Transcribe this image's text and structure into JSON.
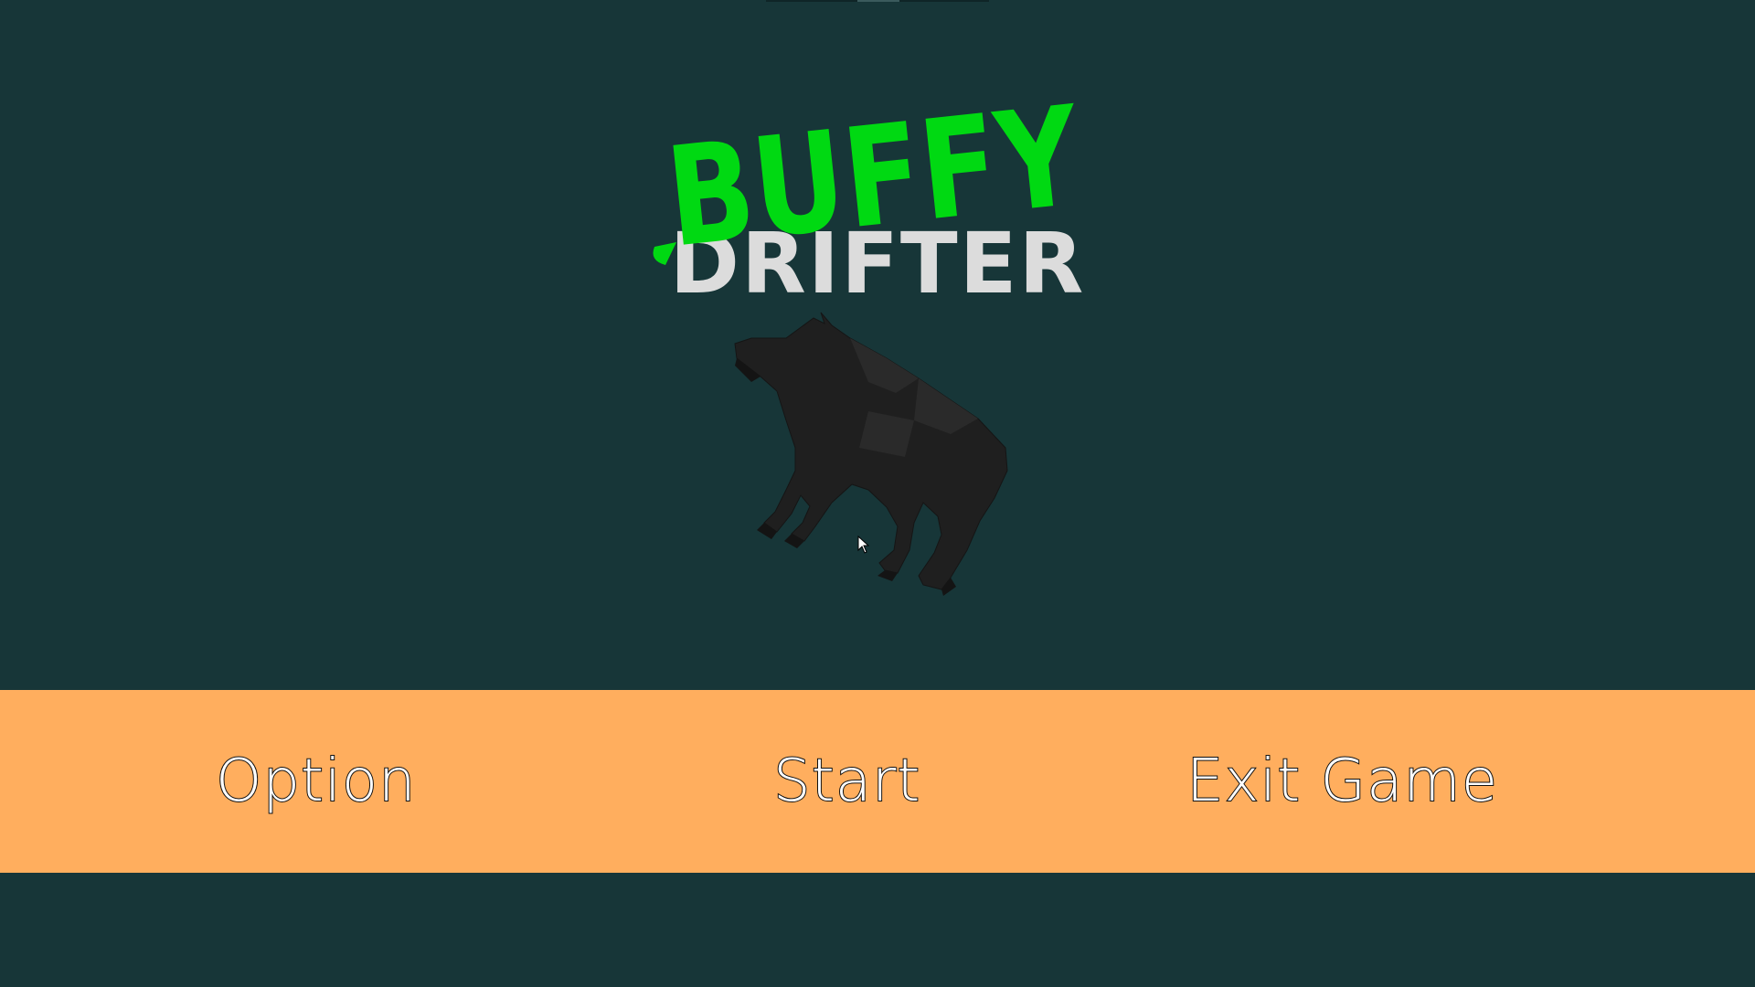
{
  "logo": {
    "word_top": "BUFFY",
    "word_bottom": "DRIFTER",
    "top_color": "#00d912",
    "bottom_color": "#dcdcdc"
  },
  "scene": {
    "background_color": "#173638",
    "character_icon": "buffalo-model"
  },
  "menu": {
    "bar_color": "#ffae5e",
    "option_label": "Option",
    "start_label": "Start",
    "exit_label": "Exit Game"
  }
}
